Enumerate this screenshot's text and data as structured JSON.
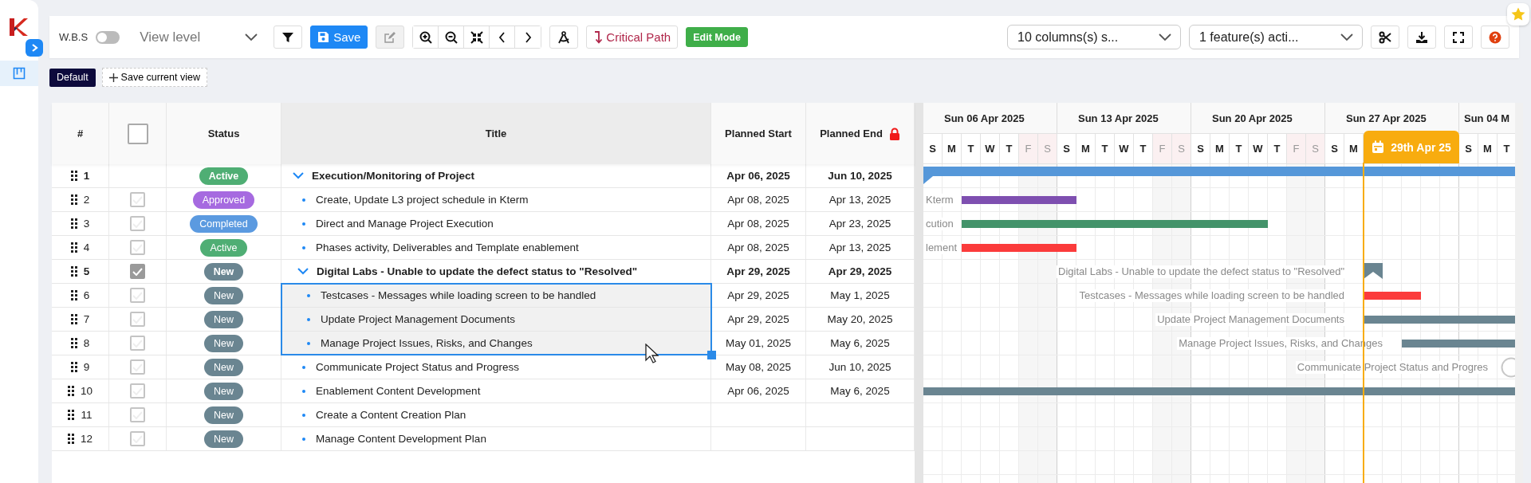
{
  "sidebar": {
    "nav": [
      {
        "selected": true
      }
    ]
  },
  "toolbar": {
    "wbs": {
      "label": "W.B.S",
      "on": false
    },
    "view_level": {
      "placeholder": "View level"
    },
    "save": {
      "label": "Save"
    },
    "edit": {
      "disabled": true
    },
    "critical_path": {
      "label": "Critical Path"
    },
    "edit_mode": {
      "label": "Edit Mode"
    },
    "columns_select": {
      "value": "10 columns(s) s..."
    },
    "features_select": {
      "value": "1 feature(s) acti..."
    }
  },
  "views": {
    "items": [
      {
        "label": "Default",
        "selected": true
      }
    ],
    "save_view": "Save current view"
  },
  "table": {
    "columns": [
      {
        "kind": "number",
        "label": "#"
      },
      {
        "kind": "checkbox",
        "checked": false
      },
      {
        "kind": "text",
        "label": "Status"
      },
      {
        "kind": "title",
        "label": "Title"
      },
      {
        "kind": "text",
        "label": "Planned Start"
      },
      {
        "kind": "text",
        "label": "Planned End",
        "locked": true
      }
    ],
    "rows": [
      {
        "number": "1",
        "kind": "group",
        "status": {
          "label": "Active",
          "color": "#4fae74"
        },
        "title": "Execution/Monitoring of Project",
        "start": "Apr 06, 2025",
        "end": "Jun 10, 2025",
        "selected": false,
        "bar": {
          "color": "#5597d9"
        },
        "children": [
          {
            "number": "2",
            "kind": "task",
            "checked": false,
            "status": {
              "label": "Approved",
              "color": "#a66ae0"
            },
            "title": "Create, Update L3 project schedule in Kterm",
            "start": "Apr 08, 2025",
            "end": "Apr 13, 2025",
            "selected": false,
            "gantt_label": "Kterm",
            "bar": {
              "color": "#7e4fb0"
            }
          },
          {
            "number": "3",
            "kind": "task",
            "checked": false,
            "status": {
              "label": "Completed",
              "color": "#5b9ae0"
            },
            "title": "Direct and Manage Project Execution",
            "start": "Apr 08, 2025",
            "end": "Apr 23, 2025",
            "selected": false,
            "gantt_label": "cution",
            "bar": {
              "color": "#43936a"
            }
          },
          {
            "number": "4",
            "kind": "task",
            "checked": false,
            "status": {
              "label": "Active",
              "color": "#4fae74"
            },
            "title": "Phases activity, Deliverables and Template enablement",
            "start": "Apr 08, 2025",
            "end": "Apr 13, 2025",
            "selected": false,
            "gantt_label": "lement",
            "bar": {
              "color": "#fb3b3b"
            }
          },
          {
            "number": "5",
            "kind": "group",
            "checked": true,
            "status": {
              "label": "New",
              "color": "#6a8591"
            },
            "title": "Digital Labs - Unable to update the defect status to \"Resolved\"",
            "start": "Apr 29, 2025",
            "end": "Apr 29, 2025",
            "selected": false,
            "gantt_label": "Digital Labs - Unable to update the defect status to \"Resolved\"",
            "bar": {
              "color": "#6a8591"
            },
            "children": [
              {
                "number": "6",
                "kind": "task",
                "checked": false,
                "status": {
                  "label": "New",
                  "color": "#6a8591"
                },
                "title": "Testcases - Messages while loading screen to be handled",
                "start": "Apr 29, 2025",
                "end": "May 1, 2025",
                "selected": true,
                "gantt_label": "Testcases - Messages while loading screen to be handled",
                "bar": {
                  "color": "#fb3b3b"
                }
              },
              {
                "number": "7",
                "kind": "task",
                "checked": false,
                "status": {
                  "label": "New",
                  "color": "#6a8591"
                },
                "title": "Update Project Management Documents",
                "start": "Apr 29, 2025",
                "end": "May 20, 2025",
                "selected": true,
                "gantt_label": "Update Project Management Documents",
                "bar": {
                  "color": "#6a8591"
                }
              },
              {
                "number": "8",
                "kind": "task",
                "checked": false,
                "status": {
                  "label": "New",
                  "color": "#6a8591"
                },
                "title": "Manage Project Issues, Risks, and Changes",
                "start": "May 01, 2025",
                "end": "May 6, 2025",
                "selected": true,
                "gantt_label": "Manage Project Issues, Risks, and Changes",
                "bar": {
                  "color": "#6a8591"
                }
              }
            ]
          },
          {
            "number": "9",
            "kind": "task",
            "checked": false,
            "status": {
              "label": "New",
              "color": "#6a8591"
            },
            "title": "Communicate Project Status and Progress",
            "start": "May 08, 2025",
            "end": "Jun 10, 2025",
            "selected": false,
            "gantt_label": "Communicate Project Status and Progres"
          },
          {
            "number": "10",
            "kind": "task",
            "checked": false,
            "status": {
              "label": "New",
              "color": "#6a8591"
            },
            "title": "Enablement Content Development",
            "start": "Apr 06, 2025",
            "end": "May 6, 2025",
            "selected": false,
            "bar": {
              "color": "#6a8591"
            }
          },
          {
            "number": "11",
            "kind": "task",
            "checked": false,
            "status": {
              "label": "New",
              "color": "#6a8591"
            },
            "title": "Create a Content Creation Plan",
            "selected": false
          },
          {
            "number": "12",
            "kind": "task",
            "checked": false,
            "status": {
              "label": "New",
              "color": "#6a8591"
            },
            "title": "Manage Content Development Plan",
            "selected": false
          }
        ]
      }
    ]
  },
  "gantt": {
    "weeks": [
      "Sun 06 Apr 2025",
      "Sun 13 Apr 2025",
      "Sun 20 Apr 2025",
      "Sun 27 Apr 2025",
      "Sun 04 M"
    ],
    "days": [
      {
        "label": "S",
        "weekend": false
      },
      {
        "label": "M",
        "weekend": false
      },
      {
        "label": "T",
        "weekend": false
      },
      {
        "label": "W",
        "weekend": false
      },
      {
        "label": "T",
        "weekend": false
      },
      {
        "label": "F",
        "weekend": true
      },
      {
        "label": "S",
        "weekend": true
      },
      {
        "label": "S",
        "weekend": false
      },
      {
        "label": "M",
        "weekend": false
      },
      {
        "label": "T",
        "weekend": false
      },
      {
        "label": "W",
        "weekend": false
      },
      {
        "label": "T",
        "weekend": false
      },
      {
        "label": "F",
        "weekend": true
      },
      {
        "label": "S",
        "weekend": true
      },
      {
        "label": "S",
        "weekend": false
      },
      {
        "label": "M",
        "weekend": false
      },
      {
        "label": "T",
        "weekend": false
      },
      {
        "label": "W",
        "weekend": false
      },
      {
        "label": "T",
        "weekend": false
      },
      {
        "label": "F",
        "weekend": true
      },
      {
        "label": "S",
        "weekend": true
      },
      {
        "label": "S",
        "weekend": false
      },
      {
        "label": "M",
        "weekend": false
      }
    ],
    "today": "29th Apr 25",
    "days_after": [
      {
        "label": "S",
        "weekend": false
      },
      {
        "label": "M",
        "weekend": false
      },
      {
        "label": "T",
        "weekend": false
      }
    ]
  }
}
